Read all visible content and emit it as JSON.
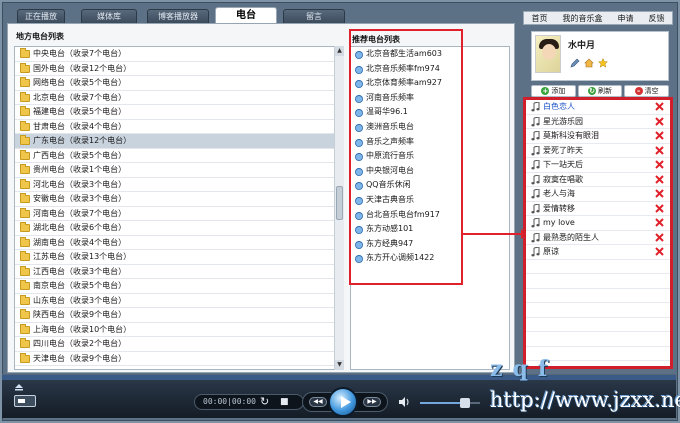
{
  "tabs": [
    {
      "label": "正在播放"
    },
    {
      "label": "媒体库"
    },
    {
      "label": "博客播放器"
    },
    {
      "label": "电台"
    },
    {
      "label": "留言"
    }
  ],
  "local_list": {
    "title": "地方电台列表",
    "items": [
      {
        "label": "中央电台（收录7个电台）"
      },
      {
        "label": "国外电台（收录12个电台）"
      },
      {
        "label": "网络电台（收录5个电台）"
      },
      {
        "label": "北京电台（收录7个电台）"
      },
      {
        "label": "福建电台（收录5个电台）"
      },
      {
        "label": "甘肃电台（收录4个电台）"
      },
      {
        "label": "广东电台（收录12个电台）"
      },
      {
        "label": "广西电台（收录5个电台）"
      },
      {
        "label": "贵州电台（收录1个电台）"
      },
      {
        "label": "河北电台（收录3个电台）"
      },
      {
        "label": "安徽电台（收录3个电台）"
      },
      {
        "label": "河南电台（收录7个电台）"
      },
      {
        "label": "湖北电台（收录6个电台）"
      },
      {
        "label": "湖南电台（收录4个电台）"
      },
      {
        "label": "江苏电台（收录13个电台）"
      },
      {
        "label": "江西电台（收录3个电台）"
      },
      {
        "label": "南京电台（收录5个电台）"
      },
      {
        "label": "山东电台（收录3个电台）"
      },
      {
        "label": "陕西电台（收录9个电台）"
      },
      {
        "label": "上海电台（收录10个电台）"
      },
      {
        "label": "四川电台（收录2个电台）"
      },
      {
        "label": "天津电台（收录9个电台）"
      }
    ]
  },
  "rec_list": {
    "title": "推荐电台列表",
    "items": [
      {
        "label": "北京音都生活am603"
      },
      {
        "label": "北京音乐频率fm974"
      },
      {
        "label": "北京体育频率am927"
      },
      {
        "label": "河南音乐频率"
      },
      {
        "label": "温哥华96.1"
      },
      {
        "label": "澳洲音乐电台"
      },
      {
        "label": "音乐之声频率"
      },
      {
        "label": "中原流行音乐"
      },
      {
        "label": "中央银河电台"
      },
      {
        "label": "QQ音乐休闲"
      },
      {
        "label": "天津古典音乐"
      },
      {
        "label": "台北音乐电台fm917"
      },
      {
        "label": "东方动感101"
      },
      {
        "label": "东方经典947"
      },
      {
        "label": "东方开心调频1422"
      }
    ]
  },
  "right": {
    "nav": [
      "首页",
      "我的音乐盒",
      "申请",
      "反馈"
    ],
    "profile_name": "水中月",
    "actions": {
      "add": "添加",
      "refresh": "刷新",
      "clear": "清空"
    },
    "playlist": [
      {
        "label": "白色恋人"
      },
      {
        "label": "星光游乐园"
      },
      {
        "label": "莫斯科没有眼泪"
      },
      {
        "label": "爱死了昨天"
      },
      {
        "label": "下一站天后"
      },
      {
        "label": "寂寞在唱歌"
      },
      {
        "label": "老人与海"
      },
      {
        "label": "爱情转移"
      },
      {
        "label": "my love"
      },
      {
        "label": "最熟悉的陌生人"
      },
      {
        "label": "原谅"
      }
    ]
  },
  "player": {
    "time": "00:00|00:00",
    "volume_fraction": 0.72
  },
  "watermark": {
    "top": "zqf",
    "url": "http://www.jzxx.net/"
  },
  "colors": {
    "highlight": "#e0202a",
    "active_track": "#1750c8"
  }
}
